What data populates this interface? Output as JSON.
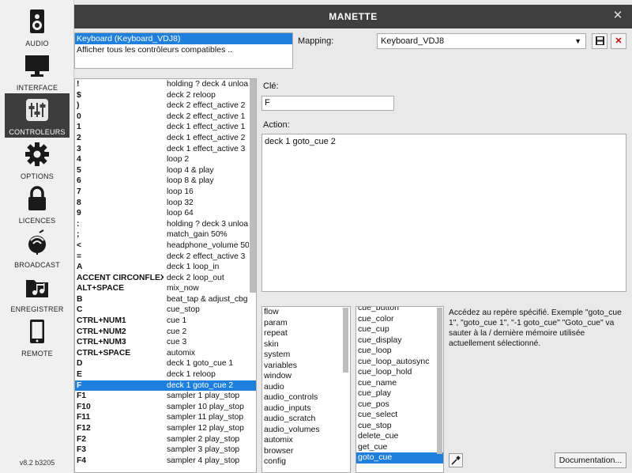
{
  "sidebar": {
    "items": [
      {
        "label": "AUDIO",
        "icon": "speaker-icon"
      },
      {
        "label": "INTERFACE",
        "icon": "monitor-icon"
      },
      {
        "label": "CONTROLEURS",
        "icon": "sliders-icon"
      },
      {
        "label": "OPTIONS",
        "icon": "gear-icon"
      },
      {
        "label": "LICENCES",
        "icon": "lock-icon"
      },
      {
        "label": "BROADCAST",
        "icon": "broadcast-icon"
      },
      {
        "label": "ENREGISTRER",
        "icon": "music-folder-icon"
      },
      {
        "label": "REMOTE",
        "icon": "tablet-icon"
      }
    ],
    "active": "CONTROLEURS",
    "version": "v8.2 b3205"
  },
  "window": {
    "title": "MANETTE",
    "close": "✕"
  },
  "controllers": [
    "Keyboard (Keyboard_VDJ8)",
    "Afficher tous les contrôleurs compatibles .."
  ],
  "mapping": {
    "label": "Mapping:",
    "value": "Keyboard_VDJ8"
  },
  "key_list": [
    {
      "key": "!",
      "action": "holding ? deck 4 unloa"
    },
    {
      "key": "$",
      "action": "deck 2 reloop"
    },
    {
      "key": ")",
      "action": "deck 2 effect_active 2"
    },
    {
      "key": "0",
      "action": "deck 2 effect_active 1"
    },
    {
      "key": "1",
      "action": "deck 1 effect_active 1"
    },
    {
      "key": "2",
      "action": "deck 1 effect_active 2"
    },
    {
      "key": "3",
      "action": "deck 1 effect_active 3"
    },
    {
      "key": "4",
      "action": "loop 2"
    },
    {
      "key": "5",
      "action": "loop 4 & play"
    },
    {
      "key": "6",
      "action": "loop 8 & play"
    },
    {
      "key": "7",
      "action": "loop 16"
    },
    {
      "key": "8",
      "action": "loop 32"
    },
    {
      "key": "9",
      "action": "loop 64"
    },
    {
      "key": ":",
      "action": "holding ? deck 3 unloa"
    },
    {
      "key": ";",
      "action": "match_gain 50%"
    },
    {
      "key": "<",
      "action": "headphone_volume 50"
    },
    {
      "key": "=",
      "action": "deck 2 effect_active 3"
    },
    {
      "key": "A",
      "action": "deck 1 loop_in"
    },
    {
      "key": "ACCENT CIRCONFLEXE",
      "action": "deck 2 loop_out"
    },
    {
      "key": "ALT+SPACE",
      "action": "mix_now"
    },
    {
      "key": "B",
      "action": "beat_tap & adjust_cbg"
    },
    {
      "key": "C",
      "action": "cue_stop"
    },
    {
      "key": "CTRL+NUM1",
      "action": "cue 1"
    },
    {
      "key": "CTRL+NUM2",
      "action": "cue 2"
    },
    {
      "key": "CTRL+NUM3",
      "action": "cue 3"
    },
    {
      "key": "CTRL+SPACE",
      "action": "automix"
    },
    {
      "key": "D",
      "action": "deck 1 goto_cue 1"
    },
    {
      "key": "E",
      "action": "deck 1 reloop"
    },
    {
      "key": "F",
      "action": "deck 1 goto_cue 2"
    },
    {
      "key": "F1",
      "action": "sampler 1 play_stop"
    },
    {
      "key": "F10",
      "action": "sampler 10 play_stop"
    },
    {
      "key": "F11",
      "action": "sampler 11 play_stop"
    },
    {
      "key": "F12",
      "action": "sampler 12 play_stop"
    },
    {
      "key": "F2",
      "action": "sampler 2 play_stop"
    },
    {
      "key": "F3",
      "action": "sampler 3 play_stop"
    },
    {
      "key": "F4",
      "action": "sampler 4 play_stop"
    }
  ],
  "selected_key": "F",
  "cle": {
    "label": "Clé:",
    "value": "F"
  },
  "action": {
    "label": "Action:",
    "value": "deck 1 goto_cue 2"
  },
  "categories": [
    "flow",
    "param",
    "repeat",
    "skin",
    "system",
    "variables",
    "window",
    "audio",
    "audio_controls",
    "audio_inputs",
    "audio_scratch",
    "audio_volumes",
    "automix",
    "browser",
    "config"
  ],
  "verbs": [
    "cue_button",
    "cue_color",
    "cue_cup",
    "cue_display",
    "cue_loop",
    "cue_loop_autosync",
    "cue_loop_hold",
    "cue_name",
    "cue_play",
    "cue_pos",
    "cue_select",
    "cue_stop",
    "delete_cue",
    "get_cue",
    "goto_cue"
  ],
  "selected_verb": "goto_cue",
  "description": "Accédez au repère spécifié. Exemple \"goto_cue 1\", \"goto_cue 1\", \"-1 goto_cue\" \"Goto_cue\" va sauter à la / dernière mémoire utilisée actuellement sélectionné.",
  "buttons": {
    "documentation": "Documentation..."
  },
  "colors": {
    "accent": "#1f7fdc",
    "titlebar": "#3f3f3f",
    "sidebar_active": "#3d3d3d"
  }
}
